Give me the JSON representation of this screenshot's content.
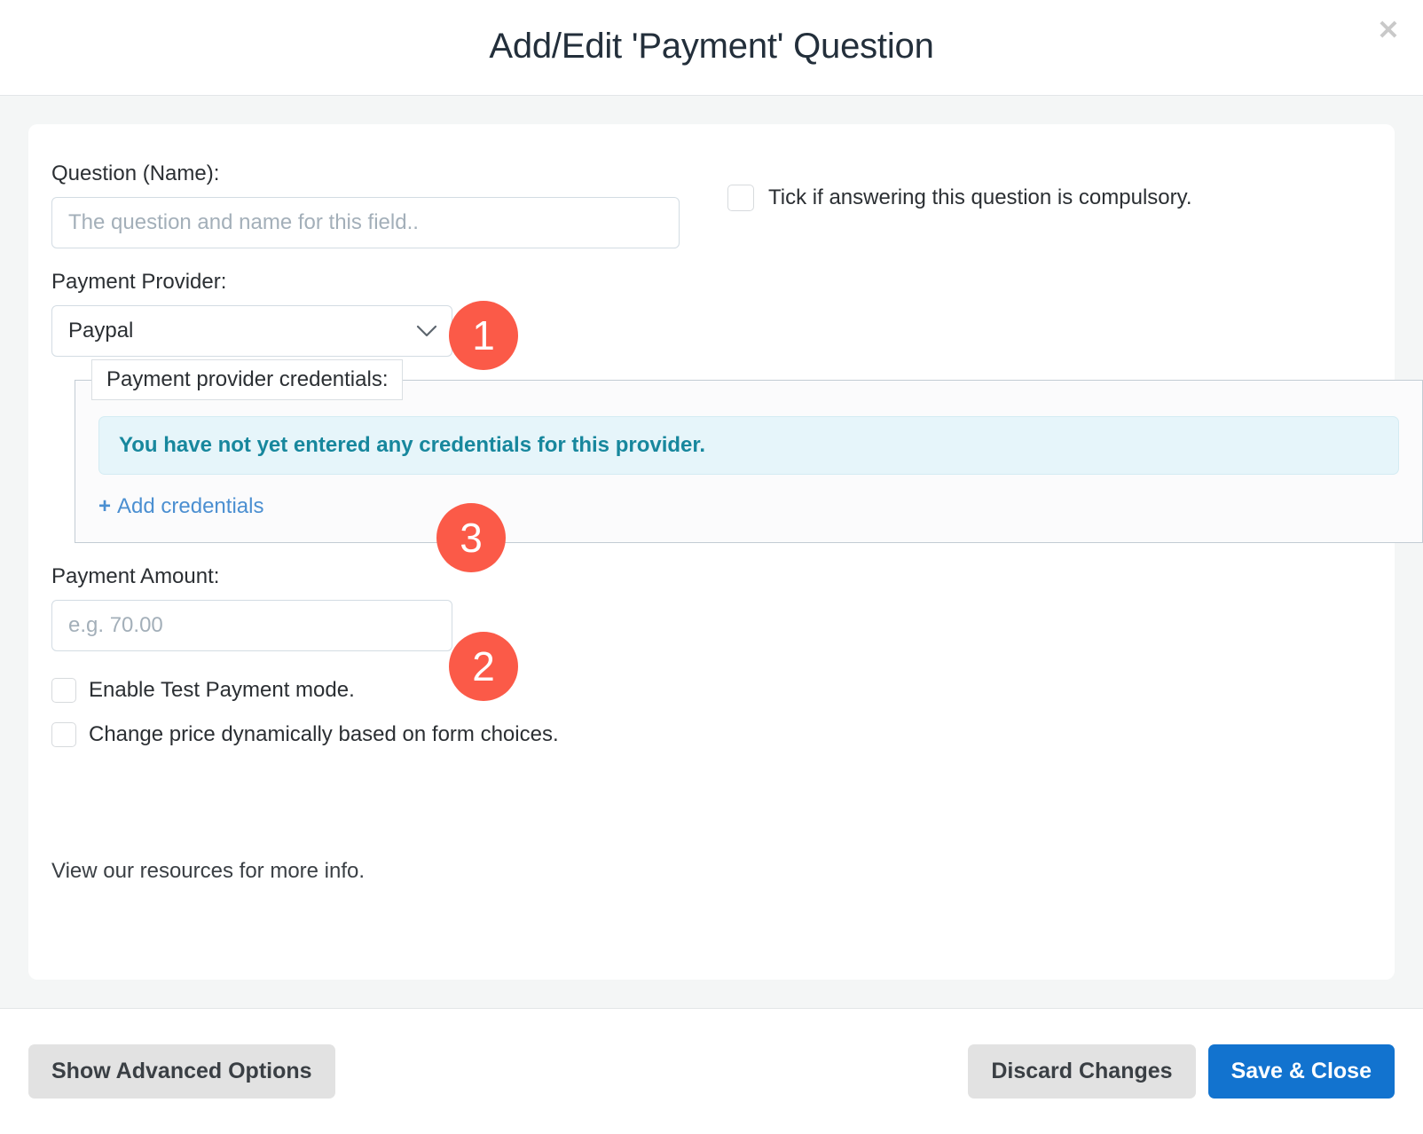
{
  "header": {
    "title": "Add/Edit 'Payment' Question",
    "close_label": "✕"
  },
  "form": {
    "question_label": "Question (Name):",
    "question_placeholder": "The question and name for this field..",
    "question_value": "",
    "compulsory_label": "Tick if answering this question is compulsory.",
    "provider_label": "Payment Provider:",
    "provider_value": "Paypal",
    "credentials_legend": "Payment provider credentials:",
    "credentials_alert": "You have not yet entered any credentials for this provider.",
    "add_credentials_label": "Add credentials",
    "plus_glyph": "+",
    "amount_label": "Payment Amount:",
    "amount_placeholder": "e.g. 70.00",
    "amount_value": "",
    "test_mode_label": "Enable Test Payment mode.",
    "dynamic_price_label": "Change price dynamically based on form choices.",
    "resources_note": "View our resources for more info."
  },
  "footer": {
    "advanced_label": "Show Advanced Options",
    "discard_label": "Discard Changes",
    "save_label": "Save & Close"
  },
  "badges": {
    "one": "1",
    "two": "2",
    "three": "3"
  },
  "colors": {
    "accent_badge": "#fb5a48",
    "primary_button": "#1273cf",
    "info_text": "#17879d",
    "info_bg": "#e6f5fa",
    "link": "#4b8fd1",
    "body_bg": "#f4f6f6"
  }
}
